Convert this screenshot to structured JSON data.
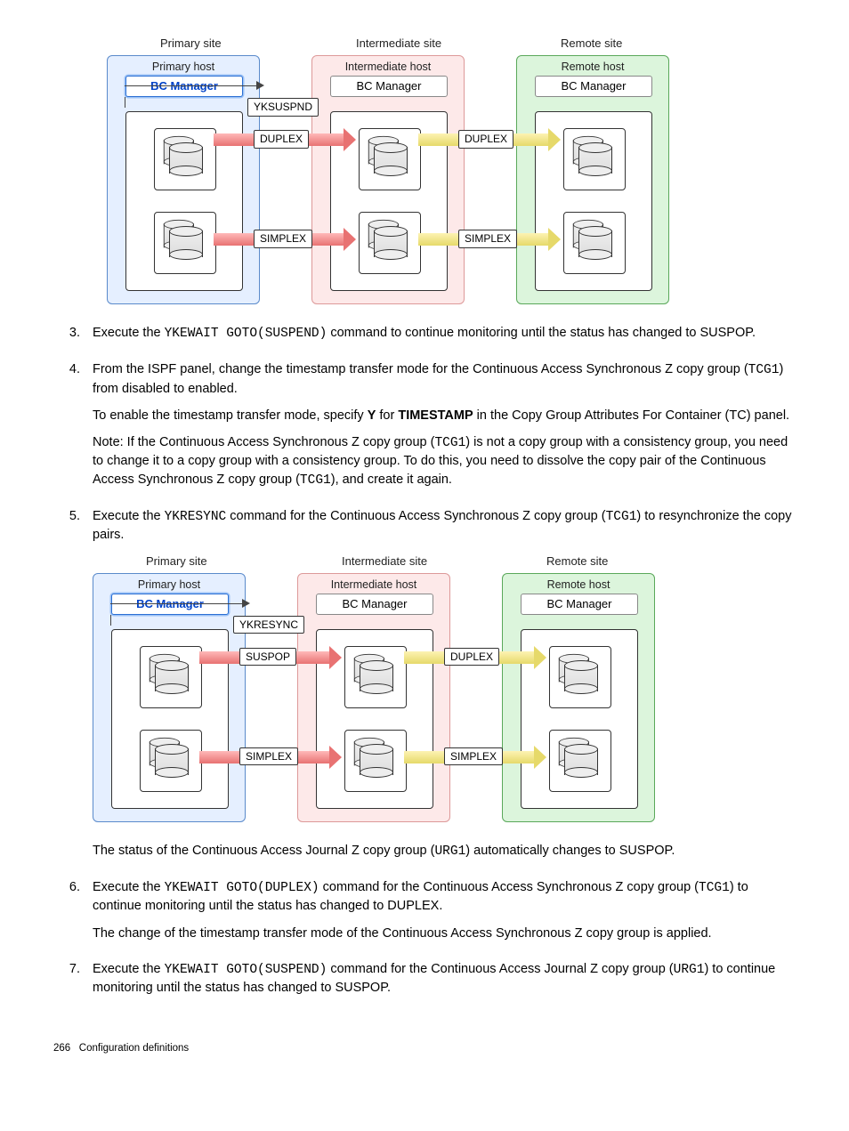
{
  "diagram1": {
    "sites": {
      "primary": "Primary site",
      "intermediate": "Intermediate site",
      "remote": "Remote site"
    },
    "hosts": {
      "primary": "Primary host",
      "intermediate": "Intermediate host",
      "remote": "Remote host"
    },
    "bcm": "BC Manager",
    "command": "YKSUSPND",
    "states": {
      "p_i_top": "DUPLEX",
      "p_i_bot": "SIMPLEX",
      "i_r_top": "DUPLEX",
      "i_r_bot": "SIMPLEX"
    }
  },
  "steps": {
    "s3": {
      "num": "3.",
      "a": "Execute the ",
      "cmd": "YKEWAIT GOTO(SUSPEND)",
      "b": " command to continue monitoring until the status has changed to SUSPOP."
    },
    "s4": {
      "num": "4.",
      "p1a": "From the ISPF panel, change the timestamp transfer mode for the Continuous Access Synchronous Z copy group (",
      "p1code": "TCG1",
      "p1b": ") from disabled to enabled.",
      "p2a": "To enable the timestamp transfer mode, specify ",
      "p2y": "Y",
      "p2b": " for ",
      "p2ts": "TIMESTAMP",
      "p2c": " in the Copy Group Attributes For Container (TC) panel.",
      "p3a": "Note: If the Continuous Access Synchronous Z copy group (",
      "p3code1": "TCG1",
      "p3b": ") is not a copy group with a consistency group, you need to change it to a copy group with a consistency group. To do this, you need to dissolve the copy pair of the Continuous Access Synchronous Z copy group (",
      "p3code2": "TCG1",
      "p3c": "), and create it again."
    },
    "s5": {
      "num": "5.",
      "a": "Execute the ",
      "cmd": "YKRESYNC",
      "b": " command for the Continuous Access Synchronous Z copy group (",
      "code": "TCG1",
      "c": ") to resynchronize the copy pairs.",
      "aftera": "The status of the Continuous Access Journal Z copy group (",
      "aftercode": "URG1",
      "afterb": ") automatically changes to SUSPOP."
    },
    "s6": {
      "num": "6.",
      "a": "Execute the ",
      "cmd": "YKEWAIT GOTO(DUPLEX)",
      "b": " command for the Continuous Access Synchronous Z copy group (",
      "code": "TCG1",
      "c": ") to continue monitoring until the status has changed to DUPLEX.",
      "p2": "The change of the timestamp transfer mode of the Continuous Access Synchronous Z copy group is applied."
    },
    "s7": {
      "num": "7.",
      "a": "Execute the ",
      "cmd": "YKEWAIT GOTO(SUSPEND)",
      "b": " command for the Continuous Access Journal Z copy group (",
      "code": "URG1",
      "c": ") to continue monitoring until the status has changed to SUSPOP."
    }
  },
  "diagram2": {
    "sites": {
      "primary": "Primary site",
      "intermediate": "Intermediate site",
      "remote": "Remote site"
    },
    "hosts": {
      "primary": "Primary host",
      "intermediate": "Intermediate host",
      "remote": "Remote host"
    },
    "bcm": "BC Manager",
    "command": "YKRESYNC",
    "states": {
      "p_i_top": "SUSPOP",
      "p_i_bot": "SIMPLEX",
      "i_r_top": "DUPLEX",
      "i_r_bot": "SIMPLEX"
    }
  },
  "footer": {
    "page": "266",
    "title": "Configuration definitions"
  }
}
